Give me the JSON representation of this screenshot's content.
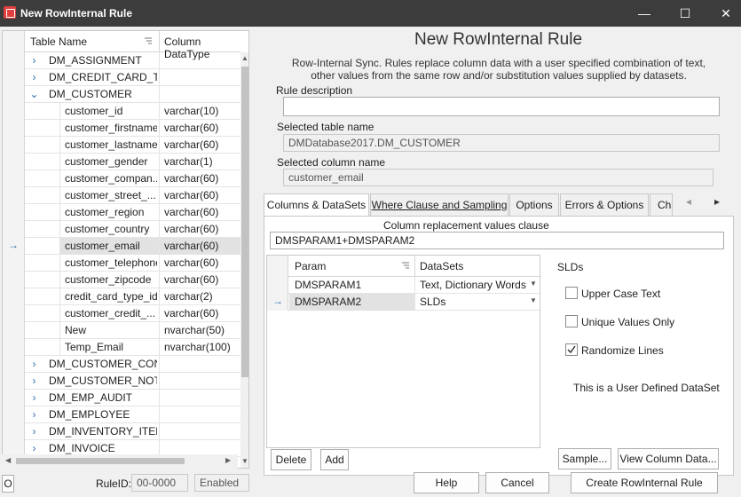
{
  "window": {
    "title": "New RowInternal Rule",
    "minimize": "—",
    "maximize": "☐",
    "close": "✕"
  },
  "grid": {
    "col_table": "Table Name",
    "col_type": "Column DataType",
    "rows": [
      {
        "name": "DM_ASSIGNMENT",
        "type": "",
        "level": 0,
        "expander": "›"
      },
      {
        "name": "DM_CREDIT_CARD_T...",
        "type": "",
        "level": 0,
        "expander": "›"
      },
      {
        "name": "DM_CUSTOMER",
        "type": "",
        "level": 0,
        "expander": "⌄"
      },
      {
        "name": "customer_id",
        "type": "varchar(10)",
        "level": 1
      },
      {
        "name": "customer_firstname",
        "type": "varchar(60)",
        "level": 1
      },
      {
        "name": "customer_lastname",
        "type": "varchar(60)",
        "level": 1
      },
      {
        "name": "customer_gender",
        "type": "varchar(1)",
        "level": 1
      },
      {
        "name": "customer_compan...",
        "type": "varchar(60)",
        "level": 1
      },
      {
        "name": "customer_street_...",
        "type": "varchar(60)",
        "level": 1
      },
      {
        "name": "customer_region",
        "type": "varchar(60)",
        "level": 1
      },
      {
        "name": "customer_country",
        "type": "varchar(60)",
        "level": 1
      },
      {
        "name": "customer_email",
        "type": "varchar(60)",
        "level": 1,
        "selected": true
      },
      {
        "name": "customer_telephone",
        "type": "varchar(60)",
        "level": 1
      },
      {
        "name": "customer_zipcode",
        "type": "varchar(60)",
        "level": 1
      },
      {
        "name": "credit_card_type_id",
        "type": "varchar(2)",
        "level": 1
      },
      {
        "name": "customer_credit_...",
        "type": "varchar(60)",
        "level": 1
      },
      {
        "name": "New",
        "type": "nvarchar(50)",
        "level": 1
      },
      {
        "name": "Temp_Email",
        "type": "nvarchar(100)",
        "level": 1
      },
      {
        "name": "DM_CUSTOMER_CON...",
        "type": "",
        "level": 0,
        "expander": "›"
      },
      {
        "name": "DM_CUSTOMER_NOTES",
        "type": "",
        "level": 0,
        "expander": "›"
      },
      {
        "name": "DM_EMP_AUDIT",
        "type": "",
        "level": 0,
        "expander": "›"
      },
      {
        "name": "DM_EMPLOYEE",
        "type": "",
        "level": 0,
        "expander": "›"
      },
      {
        "name": "DM_INVENTORY_ITEM",
        "type": "",
        "level": 0,
        "expander": "›"
      },
      {
        "name": "DM_INVOICE",
        "type": "",
        "level": 0,
        "expander": "›"
      }
    ],
    "row_indicator": "→"
  },
  "bottom": {
    "o_button": "O",
    "ruleid_label": "RuleID:",
    "ruleid_value": "00-0000",
    "enabled_value": "Enabled",
    "help": "Help",
    "cancel": "Cancel",
    "create": "Create RowInternal Rule"
  },
  "main": {
    "heading": "New RowInternal Rule",
    "description": "Row-Internal Sync. Rules replace column data with a user specified combination of text, other values from the same row and/or substitution values supplied by datasets.",
    "rule_desc_label": "Rule description",
    "rule_desc_value": "",
    "table_label": "Selected table name",
    "table_value": "DMDatabase2017.DM_CUSTOMER",
    "column_label": "Selected column name",
    "column_value": "customer_email"
  },
  "tabs": {
    "items": [
      "Columns & DataSets",
      "Where Clause and Sampling",
      "Options",
      "Errors & Options",
      "Cha"
    ],
    "prev": "◂",
    "next": "▸"
  },
  "panel": {
    "clause_label": "Column replacement values clause",
    "clause_value": "DMSPARAM1+DMSPARAM2",
    "param_col": "Param",
    "datasets_col": "DataSets",
    "params": [
      {
        "param": "DMSPARAM1",
        "dataset": "Text, Dictionary Words"
      },
      {
        "param": "DMSPARAM2",
        "dataset": "SLDs",
        "selected": true
      }
    ],
    "delete": "Delete",
    "add": "Add",
    "slds_title": "SLDs",
    "upper_case": "Upper Case Text",
    "unique_only": "Unique Values Only",
    "randomize": "Randomize Lines",
    "upper_checked": false,
    "unique_checked": false,
    "randomize_checked": true,
    "user_defined": "This is a User Defined DataSet",
    "sample": "Sample...",
    "view_column": "View Column Data..."
  }
}
